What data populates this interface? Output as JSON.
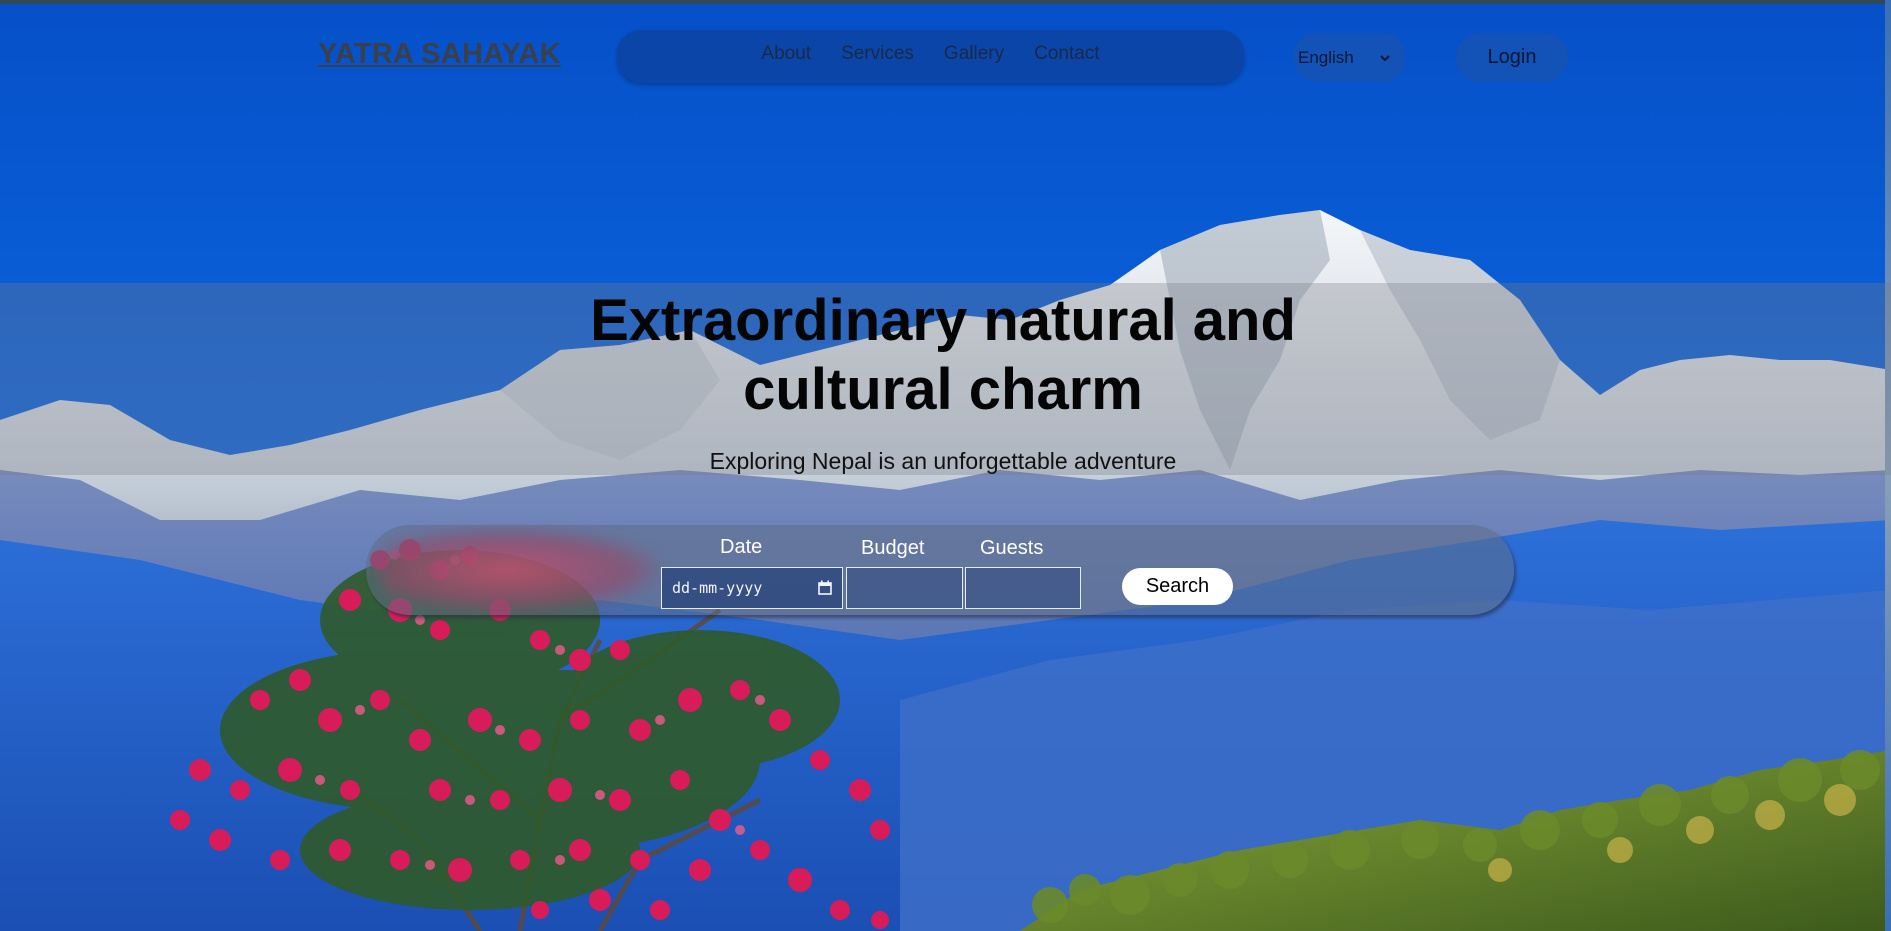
{
  "header": {
    "logo": "YATRA SAHAYAK",
    "nav": [
      {
        "label": "About"
      },
      {
        "label": "Services"
      },
      {
        "label": "Gallery"
      },
      {
        "label": "Contact"
      }
    ],
    "language": {
      "selected": "English"
    },
    "login_label": "Login"
  },
  "hero": {
    "headline_line1": "Extraordinary natural and",
    "headline_line2": "cultural charm",
    "subline": "Exploring Nepal is an unforgettable adventure"
  },
  "search": {
    "date_label": "Date",
    "date_placeholder": "dd-mm-yyyy",
    "budget_label": "Budget",
    "budget_value": "",
    "guests_label": "Guests",
    "guests_value": "",
    "button_label": "Search"
  },
  "colors": {
    "sky": "#0a5bd0",
    "nav_pill": "#0b45a8",
    "button_bg": "#ffffff"
  },
  "icons": {
    "language_dropdown": "chevron-down-icon",
    "date_picker": "calendar-icon"
  }
}
